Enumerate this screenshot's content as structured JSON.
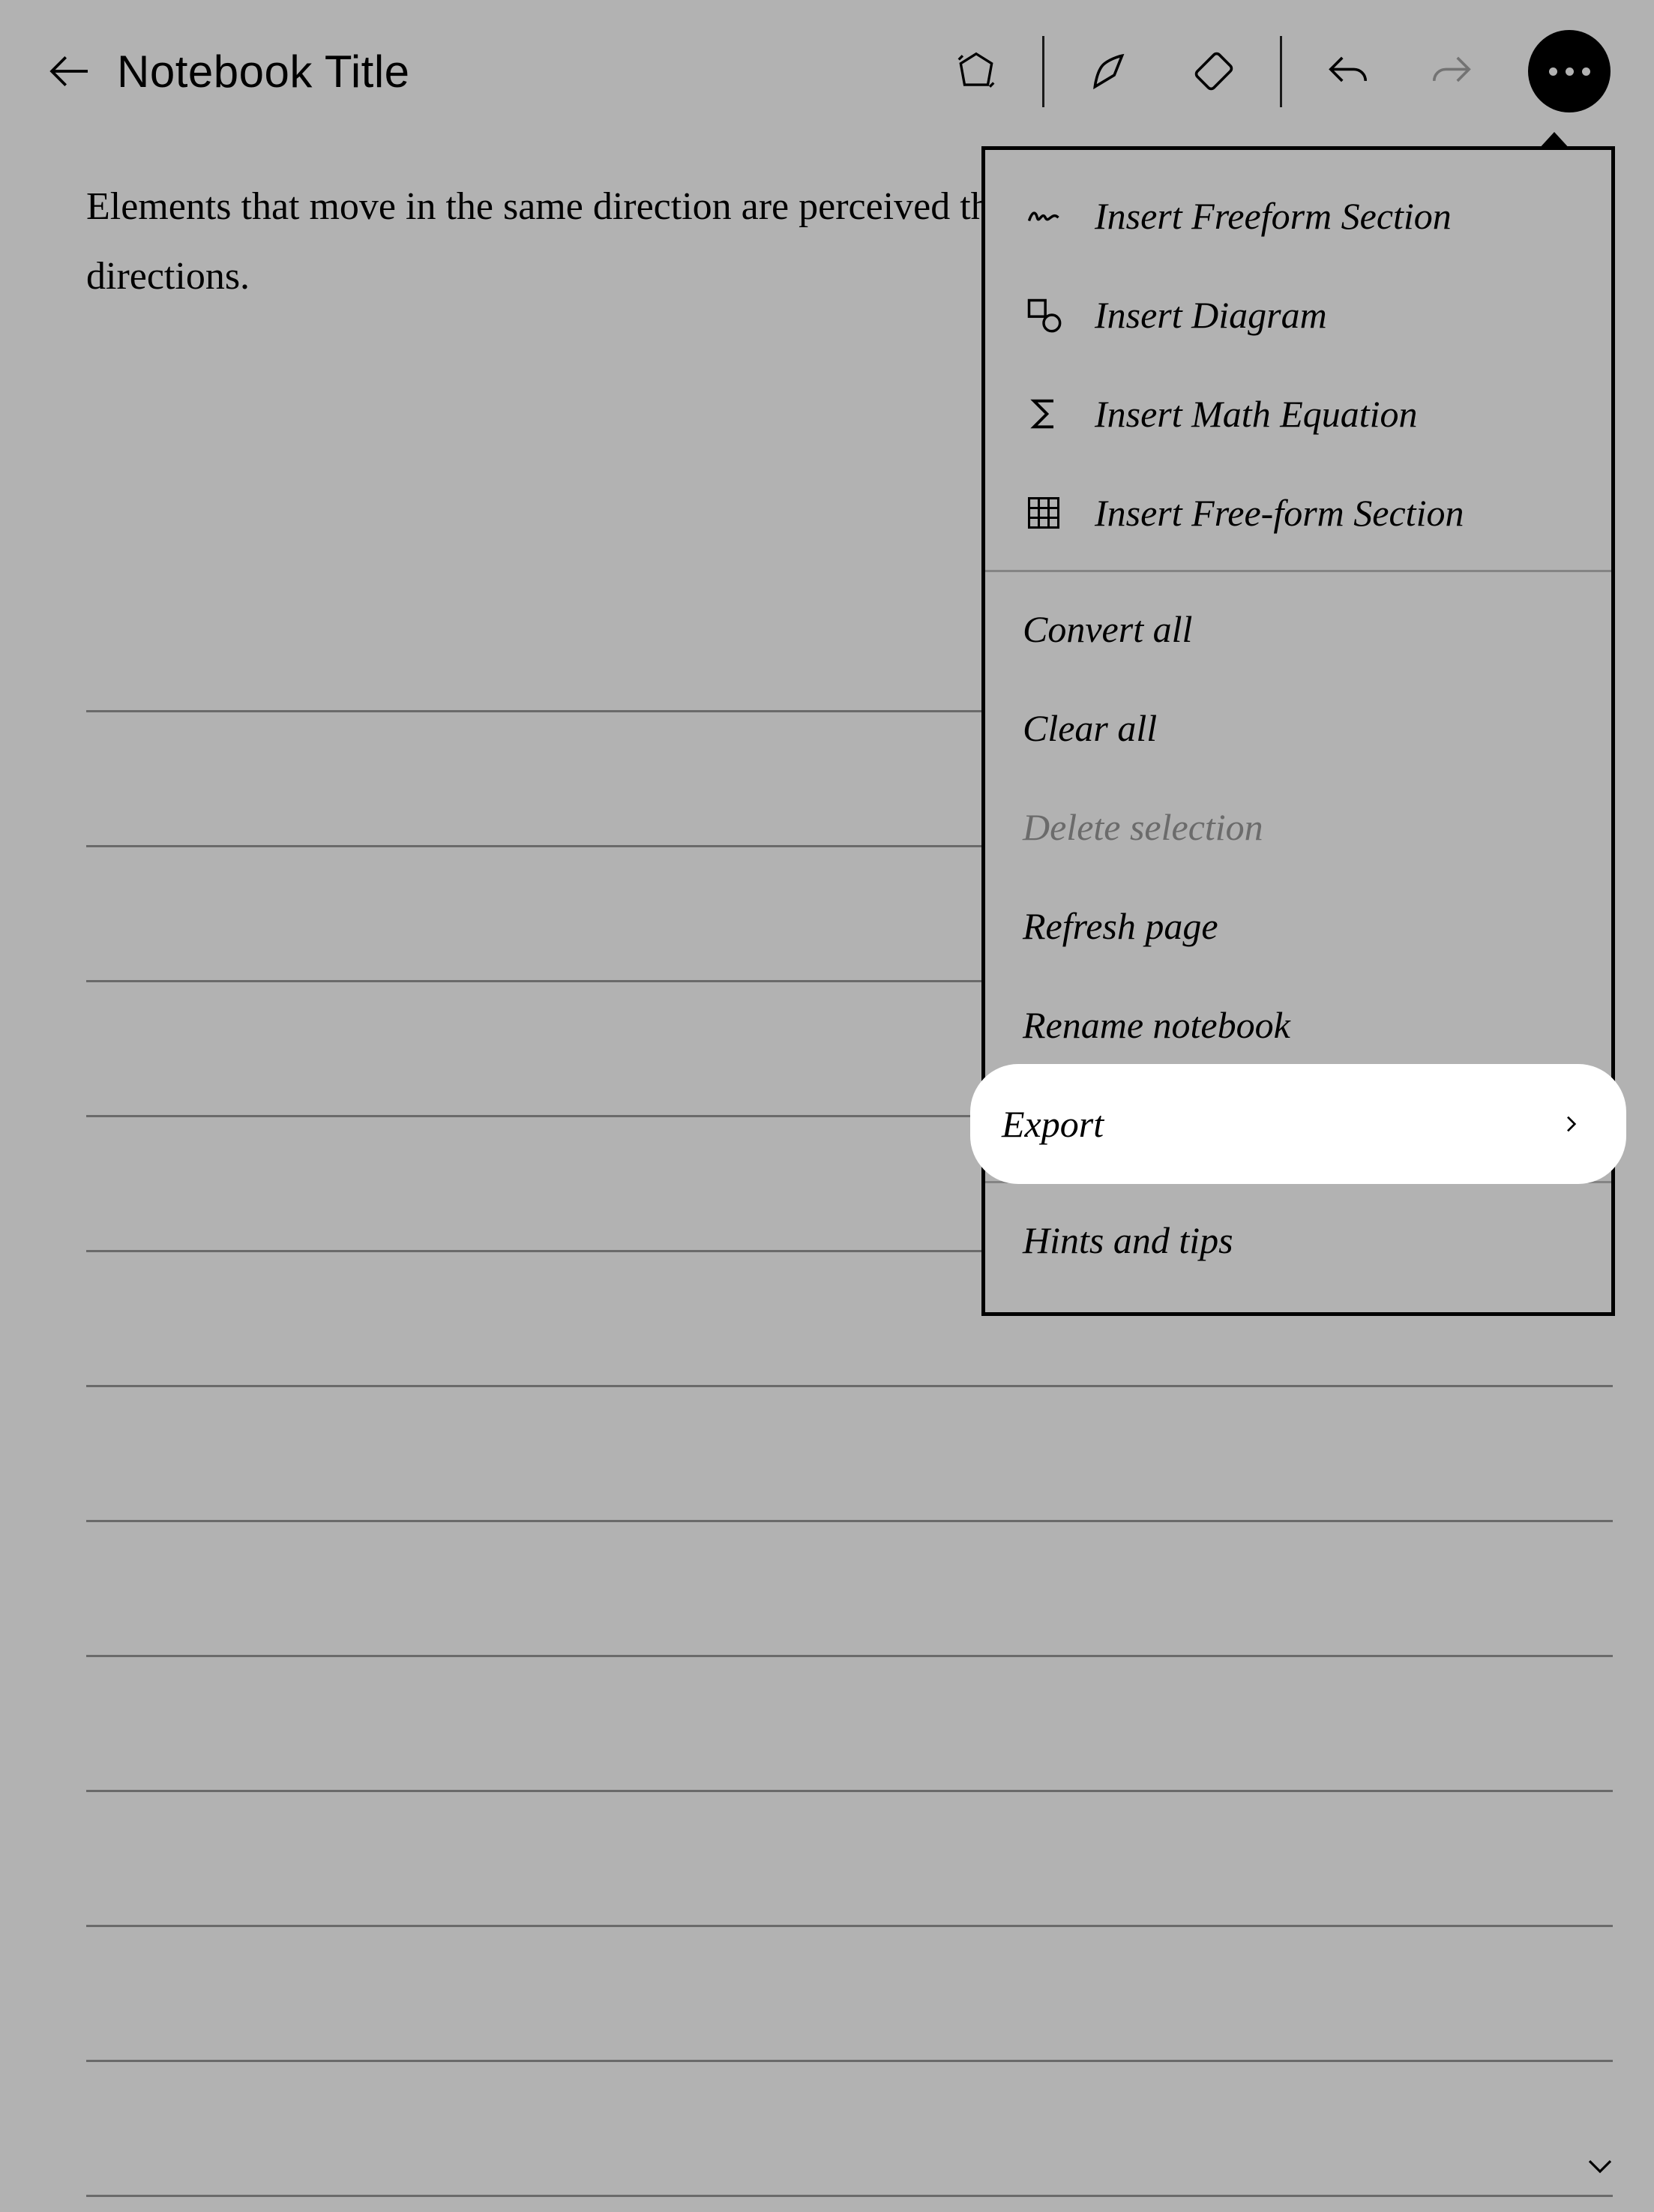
{
  "header": {
    "title": "Notebook Title"
  },
  "note": {
    "body": "Elements that move in the same direction are perceived that are stationary or move in different directions."
  },
  "menu": {
    "insert_freeform": "Insert Freeform Section",
    "insert_diagram": "Insert Diagram",
    "insert_math": "Insert Math Equation",
    "insert_freeform2": "Insert Free-form Section",
    "convert_all": "Convert all",
    "clear_all": "Clear all",
    "delete_selection": "Delete selection",
    "refresh_page": "Refresh page",
    "rename_notebook": "Rename notebook",
    "export": "Export",
    "hints_tips": "Hints and tips"
  }
}
